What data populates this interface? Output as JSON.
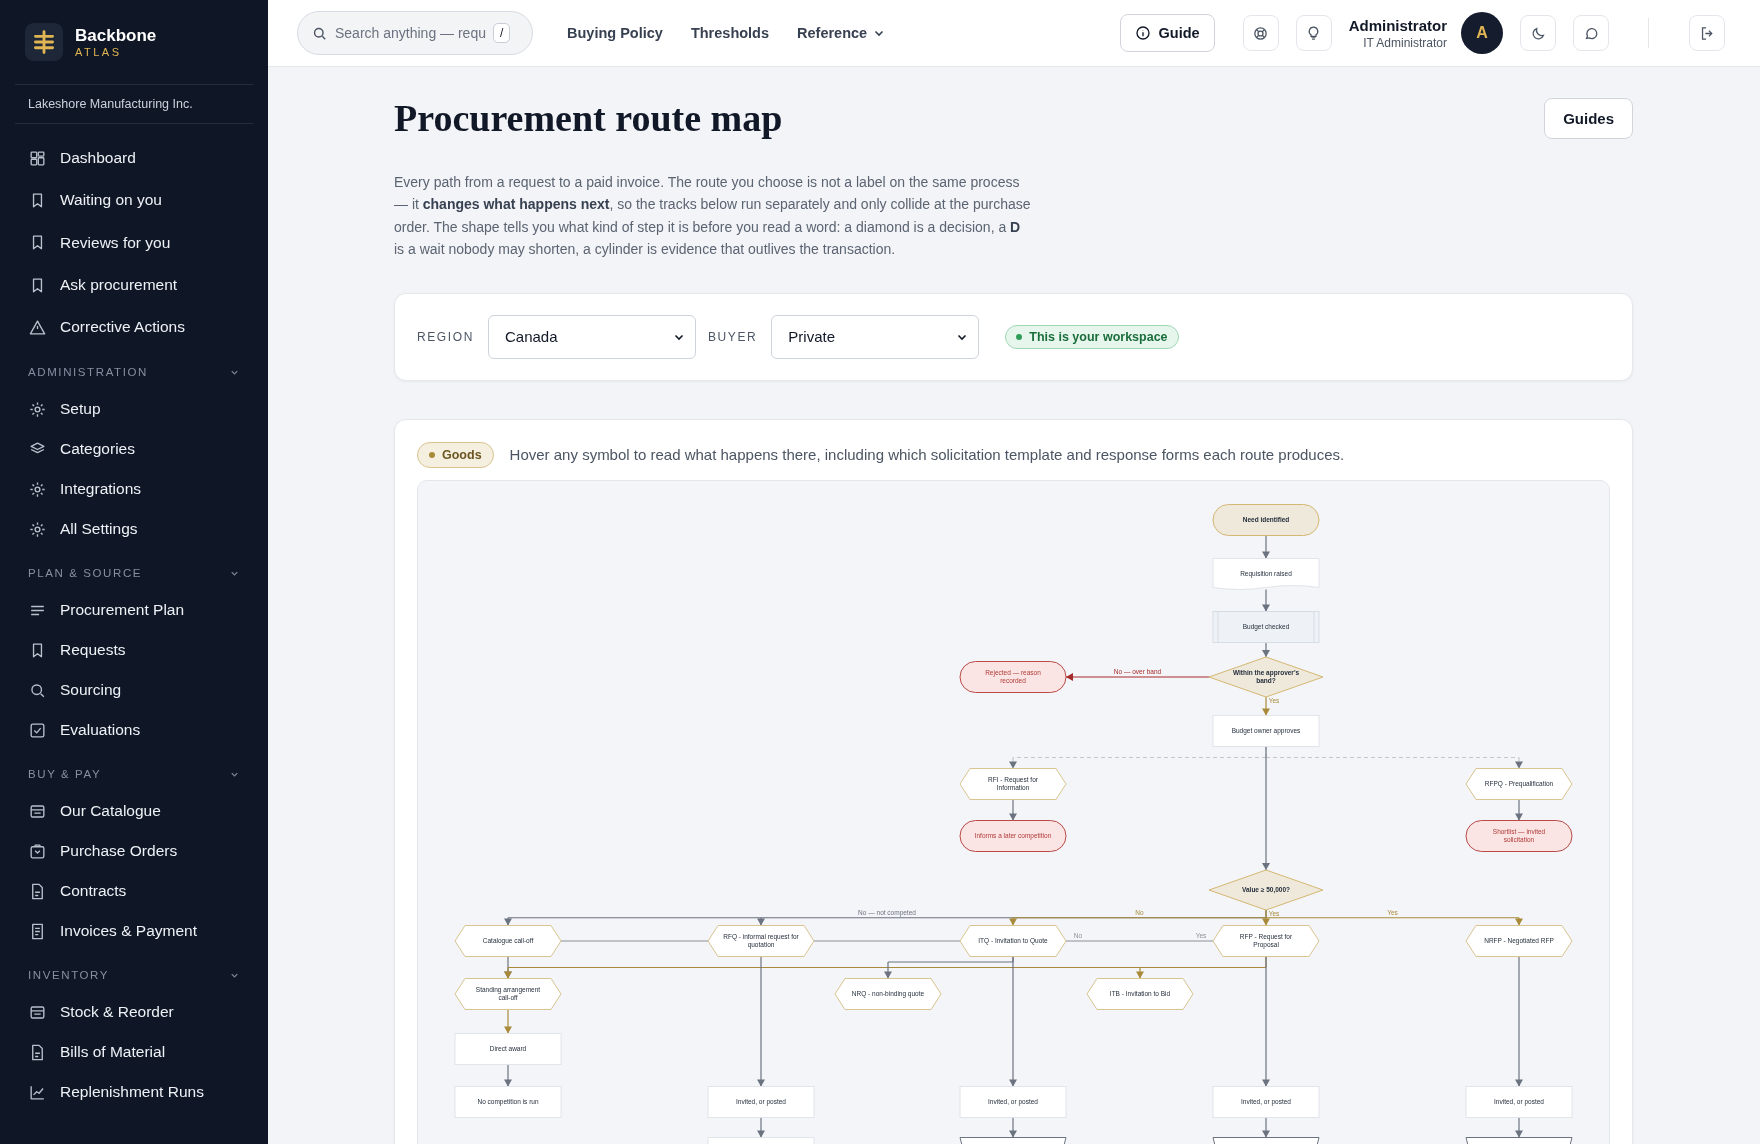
{
  "sidebar": {
    "brand": {
      "name": "Backbone",
      "subtitle": "ATLAS"
    },
    "organization": "Lakeshore Manufacturing Inc.",
    "items": [
      {
        "label": "Dashboard"
      },
      {
        "label": "Waiting on you"
      },
      {
        "label": "Reviews for you"
      },
      {
        "label": "Ask procurement"
      },
      {
        "label": "Corrective Actions"
      }
    ],
    "sections": [
      {
        "title": "ADMINISTRATION",
        "expanded": true,
        "items": [
          {
            "label": "Setup"
          },
          {
            "label": "Categories"
          },
          {
            "label": "Integrations"
          },
          {
            "label": "All Settings"
          }
        ]
      },
      {
        "title": "PLAN & SOURCE",
        "expanded": true,
        "items": [
          {
            "label": "Procurement Plan"
          },
          {
            "label": "Requests"
          },
          {
            "label": "Sourcing"
          },
          {
            "label": "Evaluations"
          }
        ]
      },
      {
        "title": "BUY & PAY",
        "expanded": true,
        "items": [
          {
            "label": "Our Catalogue"
          },
          {
            "label": "Purchase Orders"
          },
          {
            "label": "Contracts"
          },
          {
            "label": "Invoices & Payment"
          }
        ]
      },
      {
        "title": "INVENTORY",
        "expanded": true,
        "items": [
          {
            "label": "Stock & Reorder"
          },
          {
            "label": "Bills of Material"
          },
          {
            "label": "Replenishment Runs"
          }
        ]
      }
    ]
  },
  "topbar": {
    "search": {
      "placeholder": "Search anything — requ",
      "shortcut": "/"
    },
    "nav": [
      {
        "label": "Buying Policy",
        "has_menu": false
      },
      {
        "label": "Thresholds",
        "has_menu": false
      },
      {
        "label": "Reference",
        "has_menu": true
      }
    ],
    "guide_button": "Guide",
    "user": {
      "name": "Administrator",
      "role": "IT Administrator",
      "initial": "A"
    }
  },
  "page": {
    "title": "Procurement route map",
    "guides_button": "Guides",
    "intro": "Every path from a request to a paid invoice. The route you choose is not a label on the same process — it **changes what happens next**, so the tracks below run separately and only collide at the purchase order. The shape tells you what kind of step it is before you read a word: a diamond is a decision, a **D** is a wait nobody may shorten, a cylinder is evidence that outlives the transaction.",
    "filters": [
      {
        "label": "REGION",
        "value": "Canada"
      },
      {
        "label": "BUYER",
        "value": "Private"
      }
    ],
    "workspace_badge": "This is your workspace"
  },
  "route_map": {
    "category_badge": "Goods",
    "hint": "Hover any symbol to read what happens there, including which solicitation template and response forms each route produces.",
    "nodes": [
      {
        "kind": "terminal",
        "label": "Need identified"
      },
      {
        "kind": "document",
        "label": "Requisition raised"
      },
      {
        "kind": "predefined",
        "label": "Budget checked"
      },
      {
        "kind": "outcome",
        "label": "Rejected — reason recorded"
      },
      {
        "kind": "decision",
        "label": "Within the approver's band?"
      },
      {
        "kind": "process",
        "label": "Budget owner approves"
      },
      {
        "kind": "solicitation",
        "label": "RFI - Request for Information"
      },
      {
        "kind": "solicitation",
        "label": "RFPQ - Prequalification"
      },
      {
        "kind": "outcome",
        "label": "Informs a later competition"
      },
      {
        "kind": "outcome",
        "label": "Shortlist — invited solicitation"
      },
      {
        "kind": "decision",
        "label": "Value ≥ 50,000?"
      },
      {
        "kind": "solicitation",
        "label": "Catalogue call-off"
      },
      {
        "kind": "solicitation",
        "label": "RFQ - informal request for quotation"
      },
      {
        "kind": "solicitation",
        "label": "ITQ - Invitation to Quote"
      },
      {
        "kind": "solicitation",
        "label": "RFP - Request for Proposal"
      },
      {
        "kind": "solicitation",
        "label": "NRFP - Negotiated RFP"
      },
      {
        "kind": "solicitation",
        "label": "Standing arrangement call-off"
      },
      {
        "kind": "solicitation",
        "label": "NRQ - non-binding quote"
      },
      {
        "kind": "solicitation",
        "label": "ITB - Invitation to Bid"
      },
      {
        "kind": "process",
        "label": "Direct award"
      },
      {
        "kind": "process",
        "label": "No competition is run"
      },
      {
        "kind": "process",
        "label": "Invited, or posted"
      },
      {
        "kind": "process",
        "label": "Invited, or posted"
      },
      {
        "kind": "process",
        "label": "Invited, or posted"
      },
      {
        "kind": "process",
        "label": "Invited, or posted"
      },
      {
        "kind": "process"
      },
      {
        "kind": "manual"
      },
      {
        "kind": "manual"
      },
      {
        "kind": "manual"
      }
    ],
    "edge_labels": [
      "No — over band",
      "Yes",
      "No — not competed",
      "No",
      "Yes",
      "Yes",
      "No",
      "Yes"
    ]
  }
}
